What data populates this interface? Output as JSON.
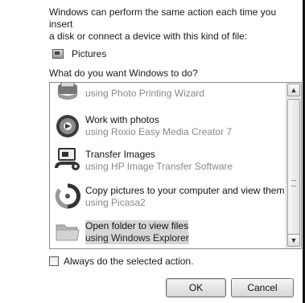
{
  "dialog": {
    "intro_line1": "Windows can perform the same action each time you insert",
    "intro_line2": "a disk or connect a device with this kind of file:",
    "content_type": "Pictures",
    "content_type_icon": "pictures-icon",
    "question": "What do you want Windows to do?"
  },
  "actions": [
    {
      "title": "",
      "subtitle": "using Photo Printing Wizard",
      "icon": "printer-icon"
    },
    {
      "title": "Work with photos",
      "subtitle": "using Roxio Easy Media Creator 7",
      "icon": "roxio-disc-icon"
    },
    {
      "title": "Transfer Images",
      "subtitle": "using HP Image Transfer Software",
      "icon": "transfer-camera-icon"
    },
    {
      "title": "Copy pictures to your computer and view them",
      "subtitle": "using Picasa2",
      "icon": "picasa-icon"
    },
    {
      "title": "Open folder to view files",
      "subtitle": "using Windows Explorer",
      "icon": "folder-icon",
      "selected": true
    }
  ],
  "scrollbar": {
    "up": "▲",
    "down": "▼"
  },
  "always_label": "Always do the selected action.",
  "always_checked": false,
  "buttons": {
    "ok": "OK",
    "cancel": "Cancel"
  }
}
